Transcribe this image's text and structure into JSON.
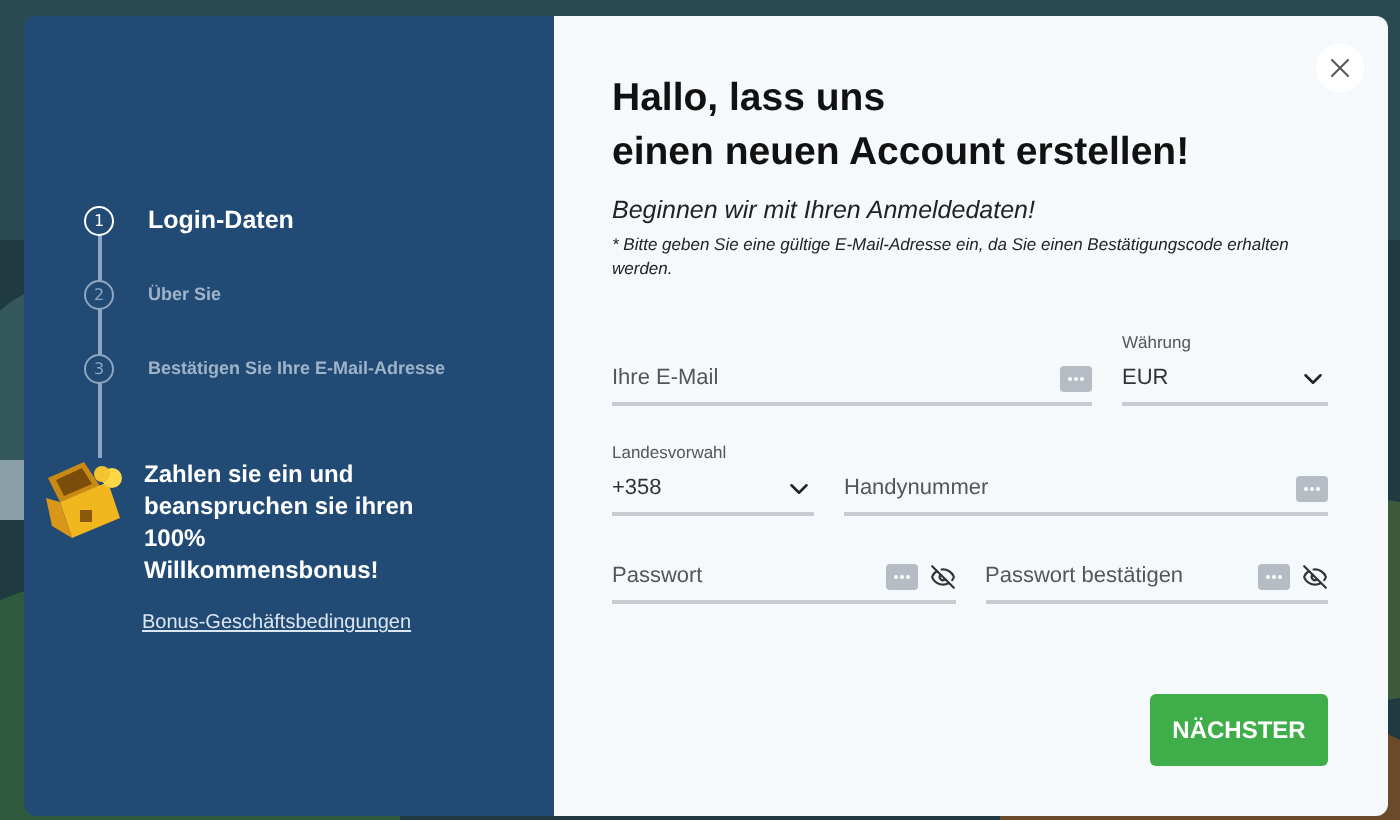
{
  "steps": [
    {
      "number": "1",
      "label": "Login-Daten",
      "selected": true
    },
    {
      "number": "2",
      "label": "Über Sie",
      "selected": false
    },
    {
      "number": "3",
      "label": "Bestätigen Sie Ihre E-Mail-Adresse",
      "selected": false
    }
  ],
  "promo": {
    "text": "Zahlen sie ein und beanspruchen sie ihren 100% Willkommensbonus!",
    "link": "Bonus-Geschäftsbedingungen"
  },
  "title_lines": [
    "Hallo, lass uns",
    "einen neuen Account erstellen!"
  ],
  "subtitle": "Beginnen wir mit Ihren Anmeldedaten!",
  "note": "* Bitte geben Sie eine gültige E-Mail-Adresse ein, da Sie einen Bestätigungscode erhalten werden.",
  "form_rows": [
    [
      {
        "kind": "text",
        "placeholder": "Ihre E-Mail"
      },
      {
        "kind": "select",
        "label": "Währung",
        "value": "EUR"
      }
    ],
    [
      {
        "kind": "select",
        "label": "Landesvorwahl",
        "value": "+358"
      },
      {
        "kind": "text",
        "placeholder": "Handynummer"
      }
    ],
    [
      {
        "kind": "password",
        "placeholder": "Passwort"
      },
      {
        "kind": "password",
        "placeholder": "Passwort bestätigen"
      }
    ]
  ],
  "next_button": "NÄCHSTER"
}
